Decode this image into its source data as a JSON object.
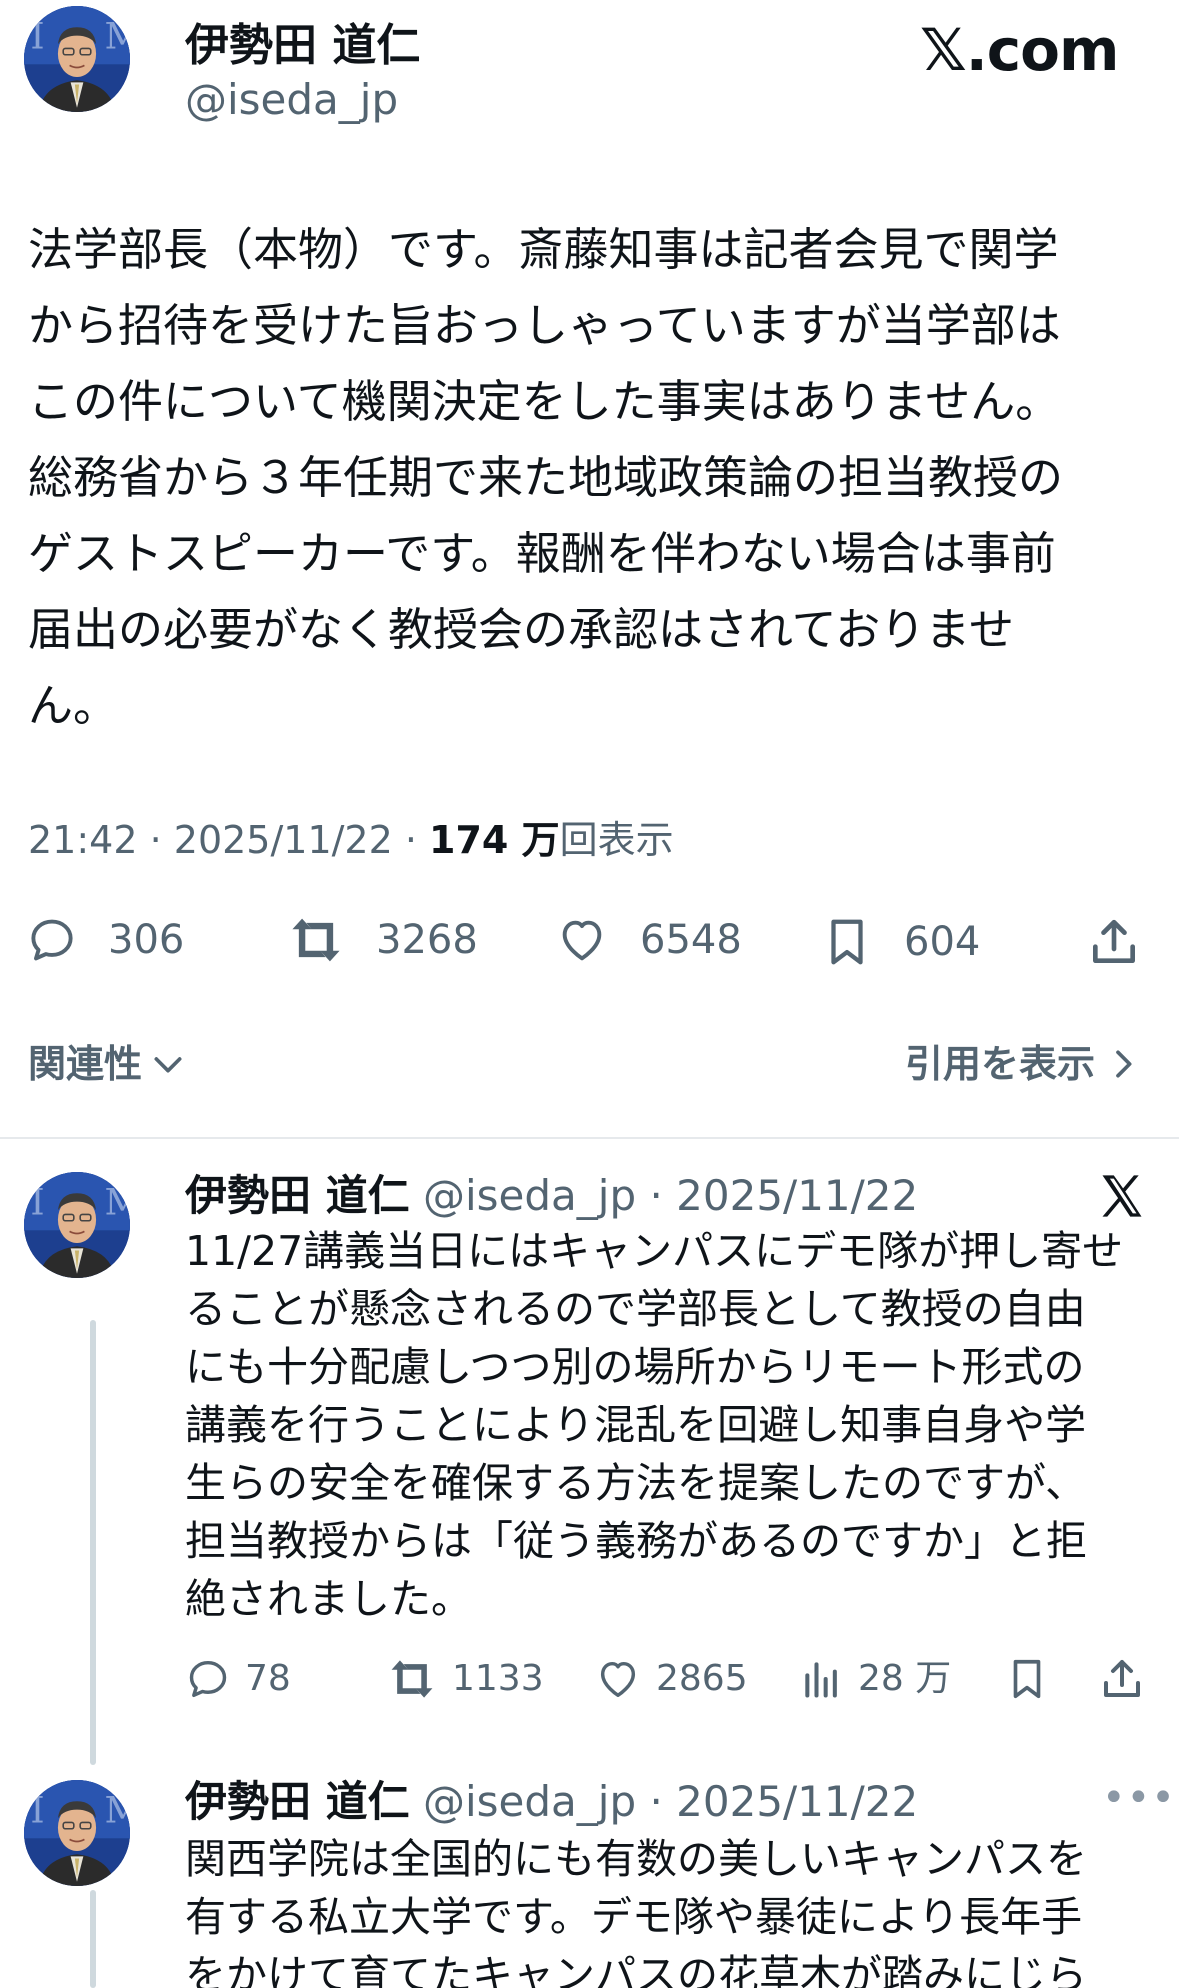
{
  "main_tweet": {
    "author_name": "伊勢田 道仁",
    "handle": "@iseda_jp",
    "brand": "𝕏.com",
    "text": "法学部長（本物）です。斎藤知事は記者会見で関学\nから招待を受けた旨おっしゃっていますが当学部は\nこの件について機関決定をした事実はありません。\n総務省から３年任期で来た地域政策論の担当教授の\nゲストスピーカーです。報酬を伴わない場合は事前\n届出の必要がなく教授会の承認はされておりませ\nん。",
    "time": "21:42",
    "date": "2025/11/22",
    "views_count": "174 万",
    "views_label": "回表示",
    "replies": "306",
    "retweets": "3268",
    "likes": "6548",
    "bookmarks": "604"
  },
  "related_label": "関連性",
  "quotes_label": "引用を表示",
  "replies": [
    {
      "author_name": "伊勢田 道仁",
      "handle_date": "@iseda_jp · 2025/11/22",
      "text": "11/27講義当日にはキャンパスにデモ隊が押し寄せ\nることが懸念されるので学部長として教授の自由\nにも十分配慮しつつ別の場所からリモート形式の\n講義を行うことにより混乱を回避し知事自身や学\n生らの安全を確保する方法を提案したのですが、\n担当教授からは「従う義務があるのですか」と拒\n絶されました。",
      "replies": "78",
      "retweets": "1133",
      "likes": "2865",
      "views": "28 万"
    },
    {
      "author_name": "伊勢田 道仁",
      "handle_date": "@iseda_jp · 2025/11/22",
      "text": "関西学院は全国的にも有数の美しいキャンパスを\n有する私立大学です。デモ隊や暴徒により長年手\nをかけて育てたキャンパスの花草木が踏みにじら"
    }
  ],
  "colors": {
    "primary_text": "#0f1419",
    "secondary_text": "#536471",
    "divider": "#e6e9ec",
    "thread_line": "#cfd9de",
    "avatar_bg": "#1d3f8f"
  },
  "icons": [
    "reply-icon",
    "retweet-icon",
    "like-icon",
    "bookmark-icon",
    "share-icon",
    "views-icon",
    "x-logo-icon",
    "chevron-down-icon",
    "chevron-right-icon",
    "more-icon"
  ]
}
